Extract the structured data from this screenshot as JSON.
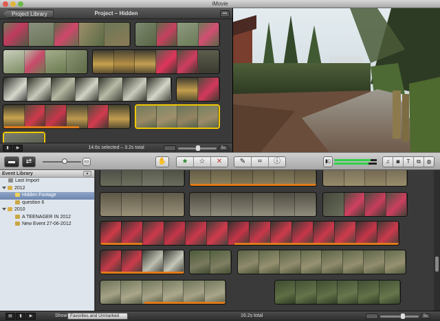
{
  "window": {
    "title": "iMovie"
  },
  "project": {
    "library_button": "Project Library",
    "title": "Project – Hidden",
    "status": "14.6s selected – 3.2s total",
    "zoom_label": "5s"
  },
  "event_library": {
    "title": "Event Library",
    "items": [
      {
        "label": "Last Import",
        "type": "event",
        "selected": false
      },
      {
        "label": "2012",
        "type": "year",
        "selected": false
      },
      {
        "label": "Hidden Footage",
        "type": "event",
        "selected": true
      },
      {
        "label": "question 6",
        "type": "event",
        "selected": false
      },
      {
        "label": "2010",
        "type": "year",
        "selected": false
      },
      {
        "label": "A TEENAGER IN 2012",
        "type": "event",
        "selected": false
      },
      {
        "label": "New Event 27-06-2012",
        "type": "event",
        "selected": false
      }
    ]
  },
  "bottom": {
    "show_label": "Show:",
    "show_value": "Favorites and Unmarked",
    "status": "16.2s total",
    "zoom_label": "5s"
  },
  "colors": {
    "selection": "#f3c700",
    "used_marker": "#e07b1a",
    "audio_level": "#2fd04a",
    "sidebar_bg": "#dfe5ec"
  },
  "icons": {
    "camera_import": "camera-icon",
    "swap": "swap-arrows-icon",
    "viewer_toggle": "viewer-icon",
    "select": "select-hand-icon",
    "favorite": "star-icon",
    "unmark": "hollow-star-icon",
    "reject": "x-icon",
    "keyword": "eyedropper-icon",
    "crop": "crop-icon",
    "inspector": "info-icon",
    "music": "music-note-icon",
    "photo": "photo-camera-icon",
    "titles": "title-t-icon",
    "transitions": "transition-icon",
    "maps": "globe-icon"
  }
}
